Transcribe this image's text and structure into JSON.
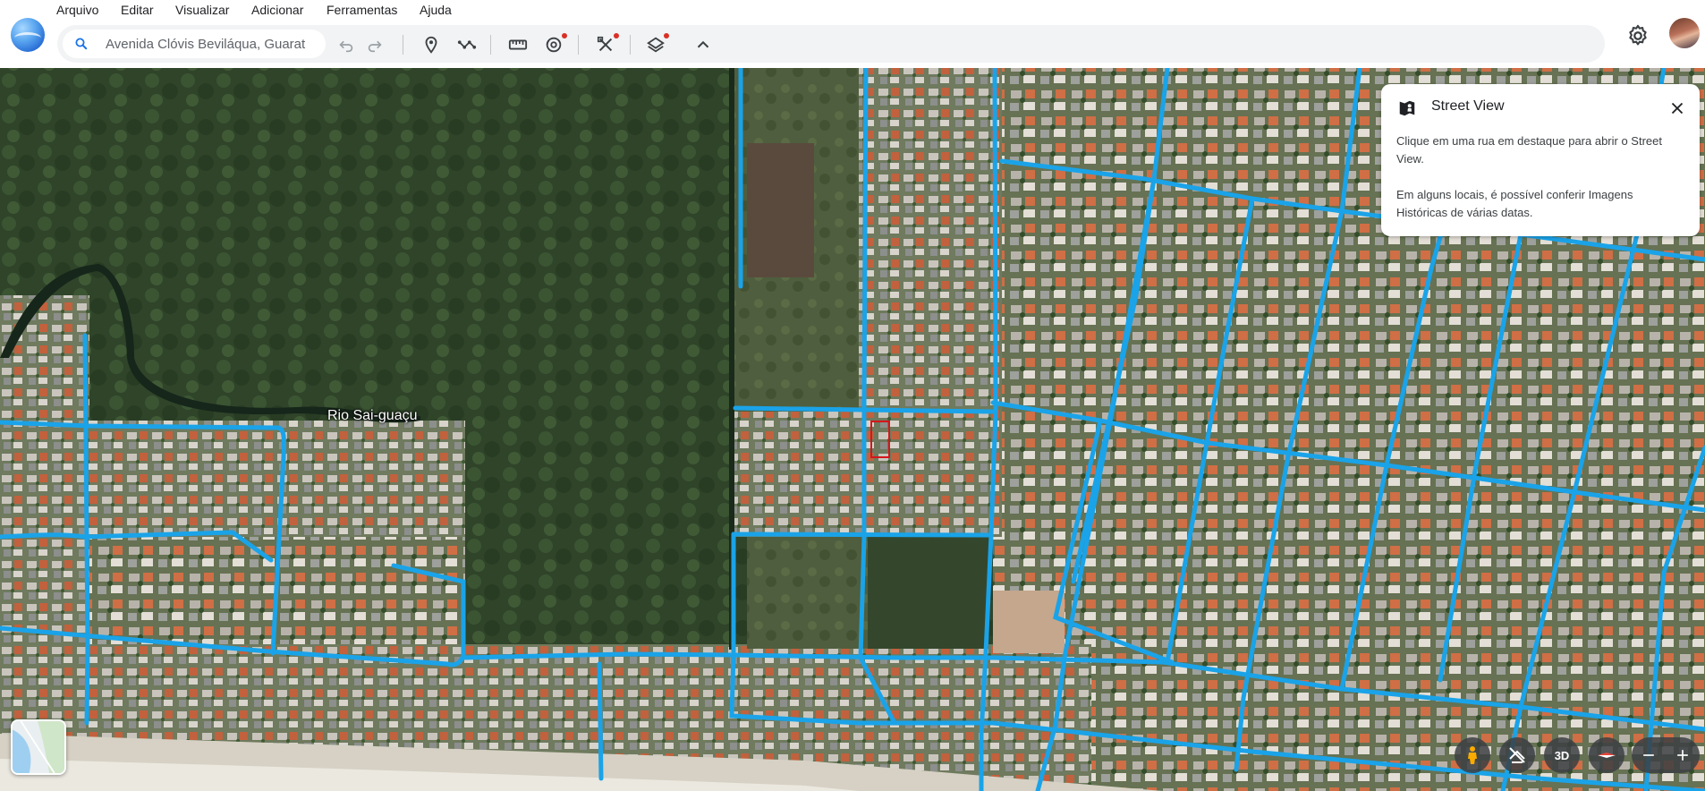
{
  "menu": {
    "items": [
      "Arquivo",
      "Editar",
      "Visualizar",
      "Adicionar",
      "Ferramentas",
      "Ajuda"
    ]
  },
  "toolbar": {
    "search_value": "Avenida Clóvis Beviláqua, Guarat",
    "icons": [
      "search-icon",
      "undo-icon",
      "redo-icon",
      "placemark-icon",
      "path-icon",
      "ruler-icon",
      "historical-imagery-icon",
      "tools-icon",
      "layers-icon",
      "collapse-icon"
    ]
  },
  "map": {
    "river_label": "Rio Sai-guaçu",
    "road_color": "#1aa3e8"
  },
  "street_view_card": {
    "title": "Street View",
    "text1": "Clique em uma rua em destaque para abrir o Street View.",
    "text2": "Em alguns locais, é possível conferir Imagens Históricas de várias datas."
  },
  "controls": {
    "three_d_label": "3D"
  },
  "colors": {
    "accent": "#1a73e8",
    "notification_dot": "#d93025"
  }
}
